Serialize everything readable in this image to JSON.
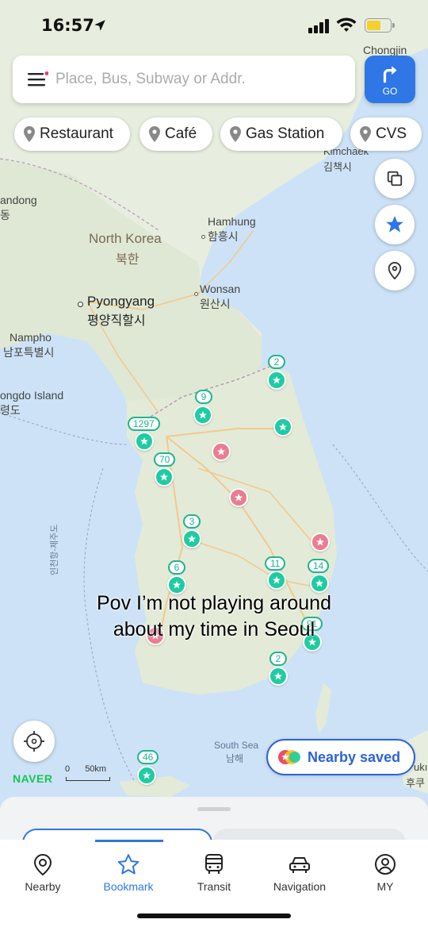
{
  "status_bar": {
    "time": "16:57"
  },
  "search": {
    "placeholder": "Place, Bus, Subway or Addr.",
    "go_label": "GO"
  },
  "chips": [
    {
      "label": "Restaurant"
    },
    {
      "label": "Café"
    },
    {
      "label": "Gas Station"
    },
    {
      "label": "CVS"
    }
  ],
  "map_labels": {
    "chongjin": "Chongjin",
    "kimchaek_en": "Kimchaek",
    "kimchaek_ko": "김책시",
    "andong_en": "andong",
    "andong_ko": "동",
    "hamhung_en": "Hamhung",
    "hamhung_ko": "함흥시",
    "north_korea_en": "North Korea",
    "north_korea_ko": "북한",
    "wonsan_en": "Wonsan",
    "wonsan_ko": "원산시",
    "pyongyang_en": "Pyongyang",
    "pyongyang_ko": "평양직할시",
    "nampho_en": "Nampho",
    "nampho_ko": "남포특별시",
    "ongdo_en": "ongdo Island",
    "ongdo_ko": "령도",
    "vertical_label": "인천항-제주도",
    "south_sea_en": "South Sea",
    "south_sea_ko": "남해",
    "fuku": "ukı",
    "fuku_ko": "후쿠"
  },
  "clusters": [
    {
      "count": "2"
    },
    {
      "count": "9"
    },
    {
      "count": "1297"
    },
    {
      "count": "70"
    },
    {
      "count": "3"
    },
    {
      "count": "6"
    },
    {
      "count": "11"
    },
    {
      "count": "14"
    },
    {
      "count": "2"
    },
    {
      "count": "46"
    },
    {
      "count": "91"
    }
  ],
  "caption": {
    "line1": "Pov I’m not playing around",
    "line2": "about my time in Seoul"
  },
  "nearby_saved": {
    "label": "Nearby saved"
  },
  "map_footer": {
    "brand": "NAVER",
    "scale_zero": "0",
    "scale_label": "50km"
  },
  "colors": {
    "accent": "#2f76e6",
    "marker_teal": "#1fcca2",
    "marker_pink": "#ea7d92",
    "naver_green": "#16c653"
  },
  "tabs": [
    {
      "label": "Nearby",
      "icon": "location-pin-icon"
    },
    {
      "label": "Bookmark",
      "icon": "star-outline-icon",
      "active": true
    },
    {
      "label": "Transit",
      "icon": "bus-icon"
    },
    {
      "label": "Navigation",
      "icon": "car-icon"
    },
    {
      "label": "MY",
      "icon": "user-circle-icon"
    }
  ]
}
